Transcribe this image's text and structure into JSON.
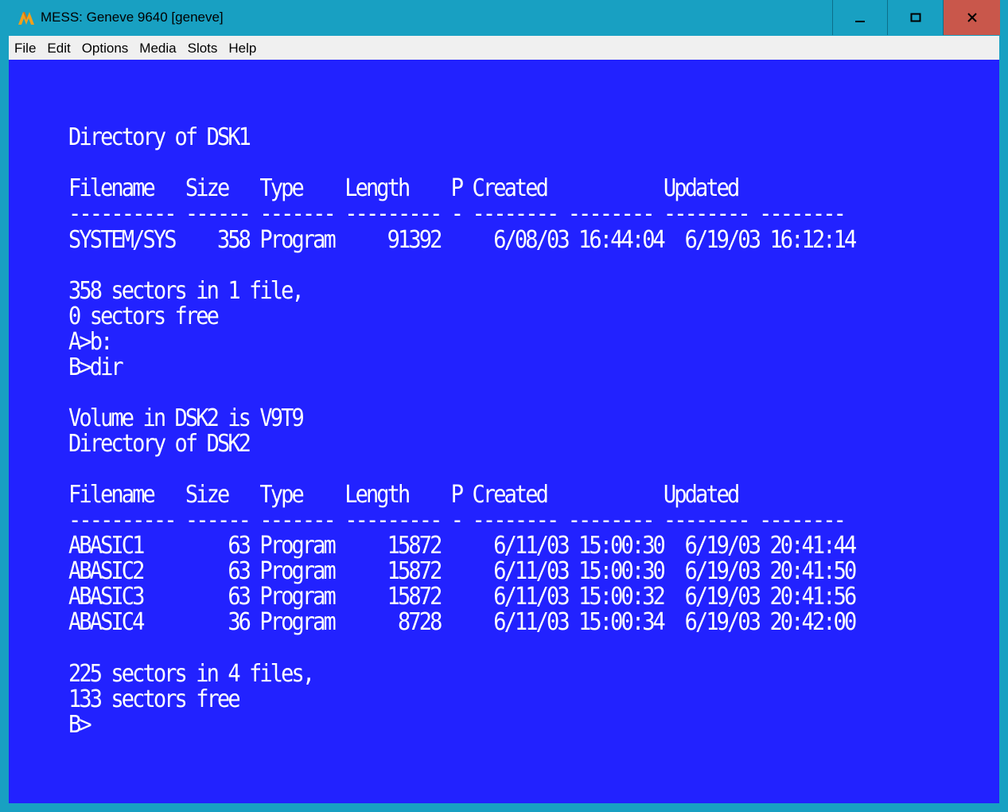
{
  "window": {
    "title": "MESS: Geneve 9640 [geneve]",
    "icon": "mess-logo-icon",
    "controls": [
      "minimize-icon",
      "maximize-icon",
      "close-icon"
    ],
    "close_color": "#c9574b",
    "frame_color": "#18a0c2"
  },
  "menu": {
    "items": [
      "File",
      "Edit",
      "Options",
      "Media",
      "Slots",
      "Help"
    ]
  },
  "screen": {
    "background": "#2222ff",
    "foreground": "#ffffff",
    "dsk1": {
      "heading": "Directory of DSK1",
      "header": "Filename   Size   Type    Length    P Created           Updated",
      "rule": "---------- ------ ------- --------- - -------- -------- -------- --------",
      "rows": [
        "SYSTEM/SYS    358 Program     91392     6/08/03 16:44:04  6/19/03 16:12:14"
      ],
      "summary1": "358 sectors in 1 file,",
      "summary2": "0 sectors free"
    },
    "commands": [
      "A>b:",
      "B>dir"
    ],
    "dsk2": {
      "volume": "Volume in DSK2 is V9T9",
      "heading": "Directory of DSK2",
      "header": "Filename   Size   Type    Length    P Created           Updated",
      "rule": "---------- ------ ------- --------- - -------- -------- -------- --------",
      "rows": [
        "ABASIC1        63 Program     15872     6/11/03 15:00:30  6/19/03 20:41:44",
        "ABASIC2        63 Program     15872     6/11/03 15:00:30  6/19/03 20:41:50",
        "ABASIC3        63 Program     15872     6/11/03 15:00:32  6/19/03 20:41:56",
        "ABASIC4        36 Program      8728     6/11/03 15:00:34  6/19/03 20:42:00"
      ],
      "summary1": "225 sectors in 4 files,",
      "summary2": "133 sectors free"
    },
    "prompt": "B>"
  }
}
